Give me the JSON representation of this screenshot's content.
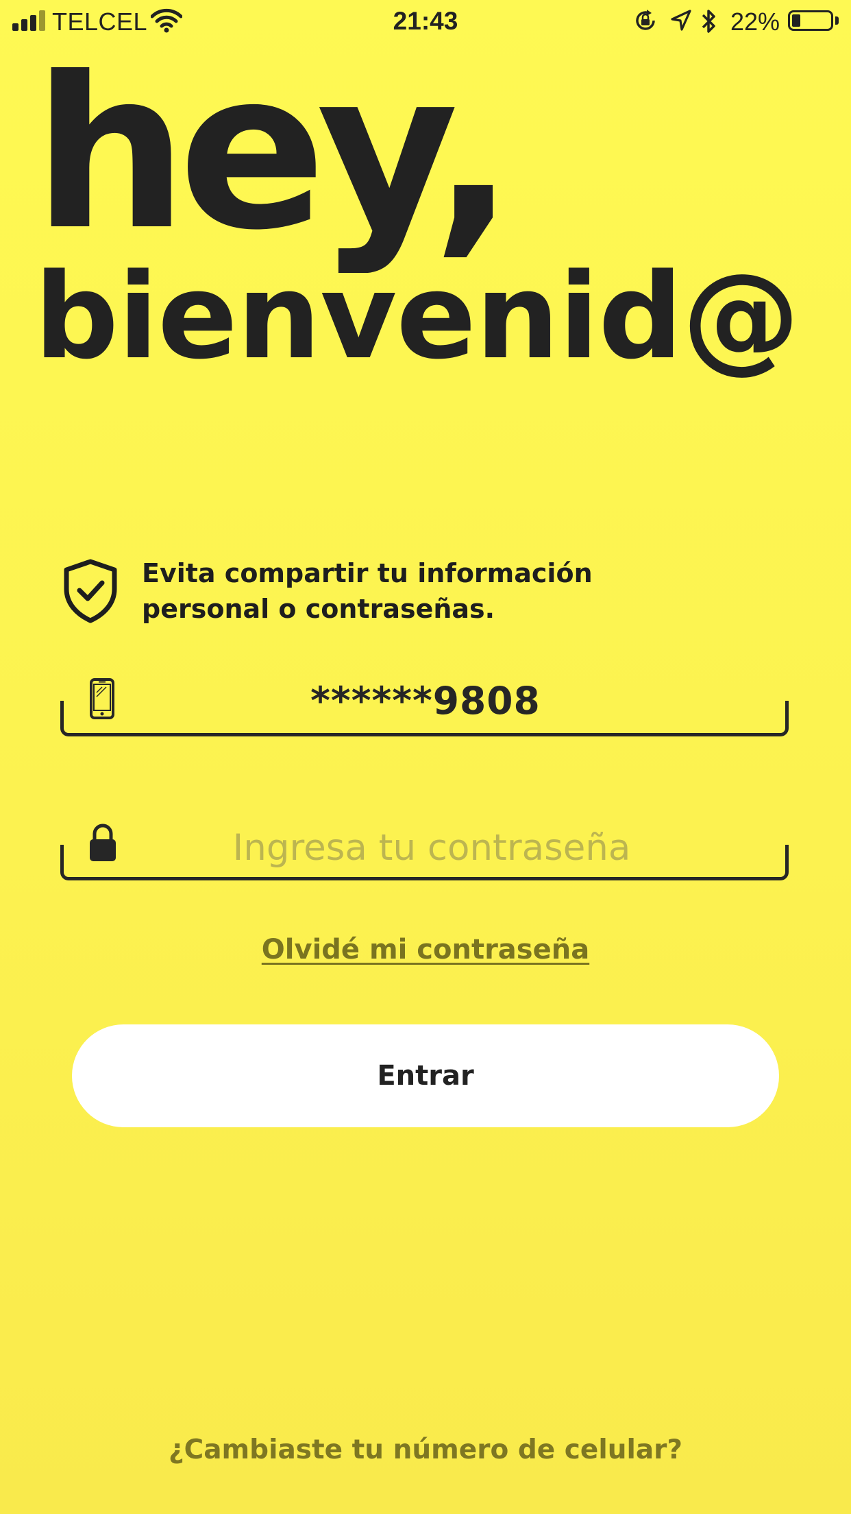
{
  "status_bar": {
    "carrier": "TELCEL",
    "time": "21:43",
    "battery_percent": "22%",
    "battery_level": 0.22,
    "signal_bars": 3,
    "signal_max": 4,
    "icons": [
      "signal-icon",
      "wifi-icon",
      "rotation-lock-icon",
      "location-icon",
      "bluetooth-icon",
      "battery-icon"
    ]
  },
  "header": {
    "greeting": "hey,",
    "welcome": "bienvenid@"
  },
  "notice": {
    "icon": "shield-check-icon",
    "text_line1": "Evita compartir tu información",
    "text_line2": "personal o contraseñas."
  },
  "login_form": {
    "phone": {
      "icon": "mobile-phone-icon",
      "value": "******9808"
    },
    "password": {
      "icon": "lock-icon",
      "placeholder": "Ingresa tu contraseña",
      "value": ""
    },
    "forgot_password_label": "Olvidé mi contraseña",
    "submit_label": "Entrar"
  },
  "footer": {
    "change_number_label": "¿Cambiaste tu número de celular?"
  },
  "colors": {
    "background": "#fcf250",
    "text": "#222222",
    "link": "#7a7420",
    "placeholder": "#bcb550",
    "button": "#ffffff"
  }
}
